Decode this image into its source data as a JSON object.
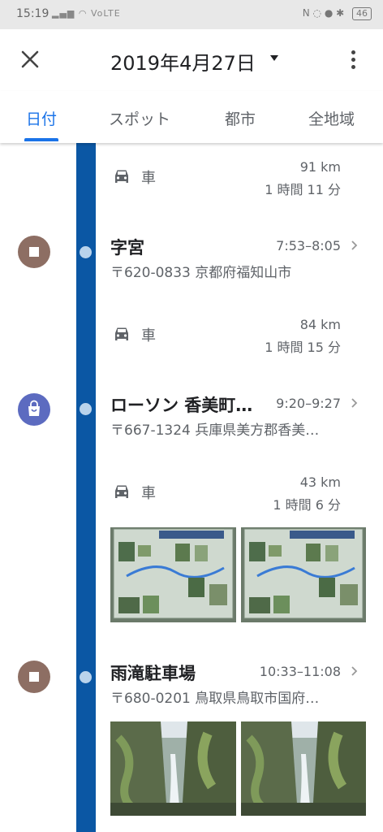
{
  "status_bar": {
    "time": "15:19",
    "signal_text": "VoLTE",
    "right_icons": "N  ◌  ●  ✱",
    "battery": "46"
  },
  "app_bar": {
    "title": "2019年4月27日",
    "close_icon": "close-icon",
    "dropdown_icon": "chevron-down-icon",
    "menu_icon": "more-vert-icon"
  },
  "tabs": [
    {
      "label": "日付",
      "active": true
    },
    {
      "label": "スポット",
      "active": false
    },
    {
      "label": "都市",
      "active": false
    },
    {
      "label": "全地域",
      "active": false
    }
  ],
  "timeline": {
    "segments": [
      {
        "mode": "車",
        "distance": "91 km",
        "duration": "1 時間 11 分"
      },
      {
        "mode": "車",
        "distance": "84 km",
        "duration": "1 時間 15 分"
      },
      {
        "mode": "車",
        "distance": "43 km",
        "duration": "1 時間 6 分"
      }
    ],
    "places": [
      {
        "name": "字宮",
        "time": "7:53–8:05",
        "address": "〒620-0833 京都府福知山市",
        "icon": "place-pin-icon",
        "color": "#8d6e63"
      },
      {
        "name": "ローソン 香美町…",
        "time": "9:20–9:27",
        "address": "〒667-1324 兵庫県美方郡香美…",
        "icon": "shopping-bag-icon",
        "color": "#5c6bc0"
      },
      {
        "name": "雨滝駐車場",
        "time": "10:33–11:08",
        "address": "〒680-0201 鳥取県鳥取市国府…",
        "icon": "place-pin-icon",
        "color": "#8d6e63"
      }
    ]
  },
  "colors": {
    "accent": "#1a73e8",
    "timeline_line": "#0b57a4",
    "timeline_dot": "#b9d3ec"
  }
}
